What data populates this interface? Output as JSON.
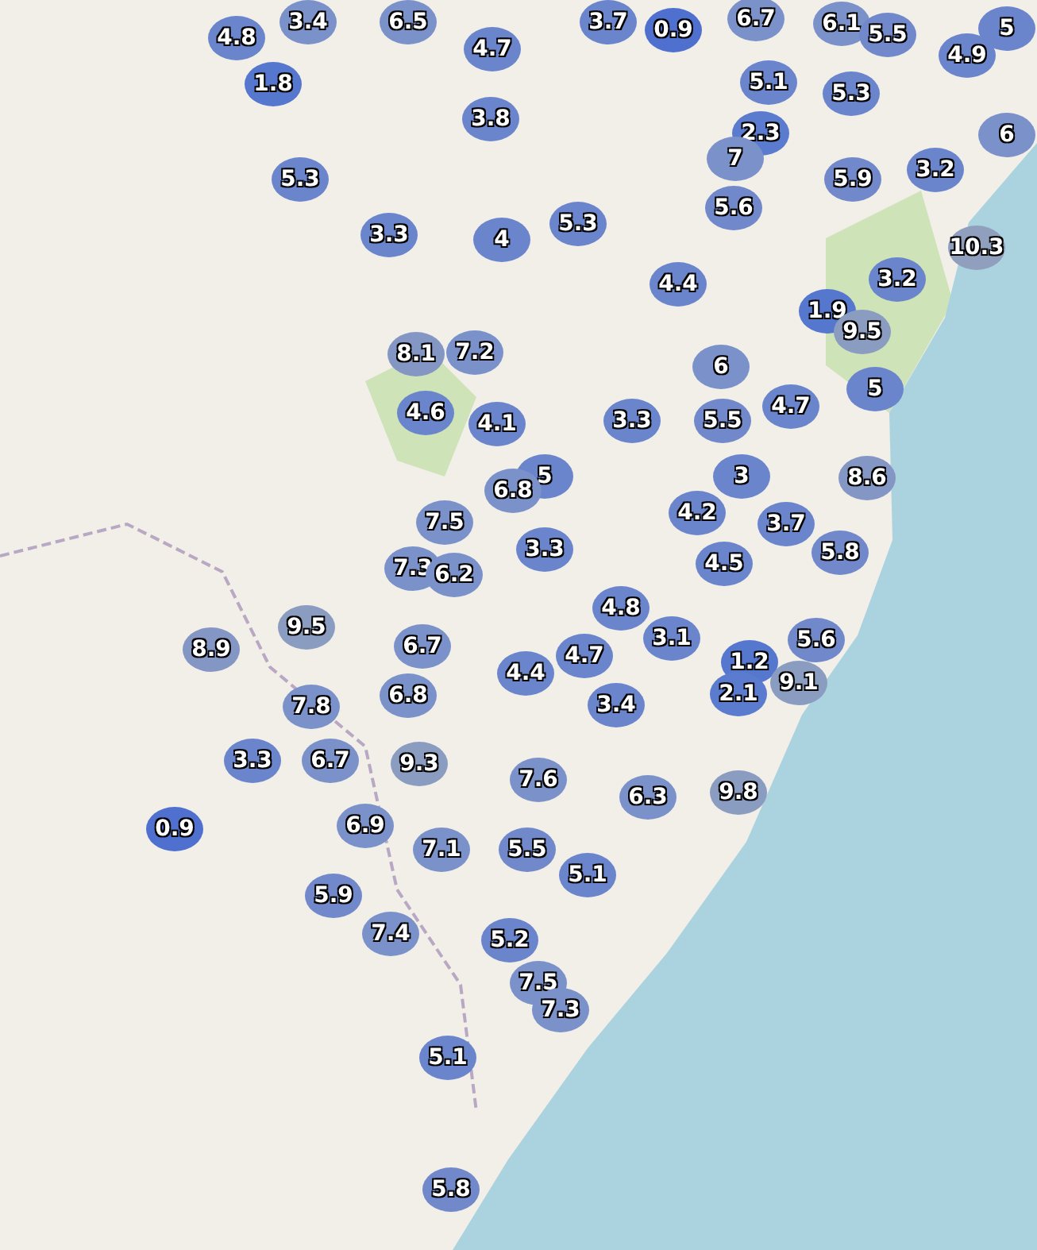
{
  "markers": [
    {
      "label": "3.4",
      "color": "#7b91c9"
    },
    {
      "label": "6.5",
      "color": "#7b91c9"
    },
    {
      "label": "3.7",
      "color": "#6a85cc"
    },
    {
      "label": "0.9",
      "color": "#4f70cf"
    },
    {
      "label": "6.7",
      "color": "#7b91c9"
    },
    {
      "label": "6.1",
      "color": "#7b91c9"
    },
    {
      "label": "5.5",
      "color": "#7189ca"
    },
    {
      "label": "5",
      "color": "#6a85cc"
    },
    {
      "label": "4.8",
      "color": "#6a85cc"
    },
    {
      "label": "4.7",
      "color": "#6a85cc"
    },
    {
      "label": "4.9",
      "color": "#6a85cc"
    },
    {
      "label": "1.8",
      "color": "#5577cd"
    },
    {
      "label": "5.1",
      "color": "#6a85cc"
    },
    {
      "label": "5.3",
      "color": "#6a85cc"
    },
    {
      "label": "3.8",
      "color": "#6a85cc"
    },
    {
      "label": "2.3",
      "color": "#5a7bce"
    },
    {
      "label": "6",
      "color": "#7b91c9"
    },
    {
      "label": "7",
      "color": "#7b91c9"
    },
    {
      "label": "5.3",
      "color": "#6a85cc"
    },
    {
      "label": "5.9",
      "color": "#7189ca"
    },
    {
      "label": "3.2",
      "color": "#6a85cc"
    },
    {
      "label": "5.3",
      "color": "#6a85cc"
    },
    {
      "label": "5.6",
      "color": "#7189ca"
    },
    {
      "label": "3.3",
      "color": "#6a85cc"
    },
    {
      "label": "4",
      "color": "#6a85cc"
    },
    {
      "label": "10.3",
      "color": "#909fbd"
    },
    {
      "label": "3.2",
      "color": "#6a85cc"
    },
    {
      "label": "4.4",
      "color": "#6a85cc"
    },
    {
      "label": "1.9",
      "color": "#5577cd"
    },
    {
      "label": "9.5",
      "color": "#8a9cc0"
    },
    {
      "label": "8.1",
      "color": "#8496c4"
    },
    {
      "label": "7.2",
      "color": "#7b91c9"
    },
    {
      "label": "6",
      "color": "#7b91c9"
    },
    {
      "label": "4.7",
      "color": "#6a85cc"
    },
    {
      "label": "5",
      "color": "#6a85cc"
    },
    {
      "label": "4.6",
      "color": "#6a85cc"
    },
    {
      "label": "4.1",
      "color": "#6a85cc"
    },
    {
      "label": "3.3",
      "color": "#6a85cc"
    },
    {
      "label": "5.5",
      "color": "#7189ca"
    },
    {
      "label": "5",
      "color": "#6a85cc"
    },
    {
      "label": "6.8",
      "color": "#7b91c9"
    },
    {
      "label": "3",
      "color": "#6a85cc"
    },
    {
      "label": "8.6",
      "color": "#8496c4"
    },
    {
      "label": "4.2",
      "color": "#6a85cc"
    },
    {
      "label": "7.5",
      "color": "#7b91c9"
    },
    {
      "label": "3.7",
      "color": "#6a85cc"
    },
    {
      "label": "5.8",
      "color": "#7189ca"
    },
    {
      "label": "3.3",
      "color": "#6a85cc"
    },
    {
      "label": "7.3",
      "color": "#7b91c9"
    },
    {
      "label": "6.2",
      "color": "#7b91c9"
    },
    {
      "label": "4.5",
      "color": "#6a85cc"
    },
    {
      "label": "4.8",
      "color": "#6a85cc"
    },
    {
      "label": "9.5",
      "color": "#8a9cc0"
    },
    {
      "label": "8.9",
      "color": "#8496c4"
    },
    {
      "label": "3.1",
      "color": "#6a85cc"
    },
    {
      "label": "6.7",
      "color": "#7b91c9"
    },
    {
      "label": "5.6",
      "color": "#7189ca"
    },
    {
      "label": "4.7",
      "color": "#6a85cc"
    },
    {
      "label": "4.4",
      "color": "#6a85cc"
    },
    {
      "label": "1.2",
      "color": "#5577cd"
    },
    {
      "label": "9.1",
      "color": "#8a9cc0"
    },
    {
      "label": "2.1",
      "color": "#5a7bce"
    },
    {
      "label": "3.4",
      "color": "#6a85cc"
    },
    {
      "label": "6.8",
      "color": "#7b91c9"
    },
    {
      "label": "7.8",
      "color": "#7b91c9"
    },
    {
      "label": "3.3",
      "color": "#6a85cc"
    },
    {
      "label": "6.7",
      "color": "#7b91c9"
    },
    {
      "label": "9.3",
      "color": "#8a9cc0"
    },
    {
      "label": "7.6",
      "color": "#7b91c9"
    },
    {
      "label": "6.3",
      "color": "#7b91c9"
    },
    {
      "label": "9.8",
      "color": "#8a9cc0"
    },
    {
      "label": "0.9",
      "color": "#4f70cf"
    },
    {
      "label": "6.9",
      "color": "#7b91c9"
    },
    {
      "label": "7.1",
      "color": "#7b91c9"
    },
    {
      "label": "5.5",
      "color": "#7189ca"
    },
    {
      "label": "5.1",
      "color": "#6a85cc"
    },
    {
      "label": "5.9",
      "color": "#7189ca"
    },
    {
      "label": "7.4",
      "color": "#7b91c9"
    },
    {
      "label": "5.2",
      "color": "#6a85cc"
    },
    {
      "label": "7.5",
      "color": "#7b91c9"
    },
    {
      "label": "7.3",
      "color": "#7b91c9"
    },
    {
      "label": "5.1",
      "color": "#6a85cc"
    },
    {
      "label": "5.8",
      "color": "#7189ca"
    }
  ]
}
